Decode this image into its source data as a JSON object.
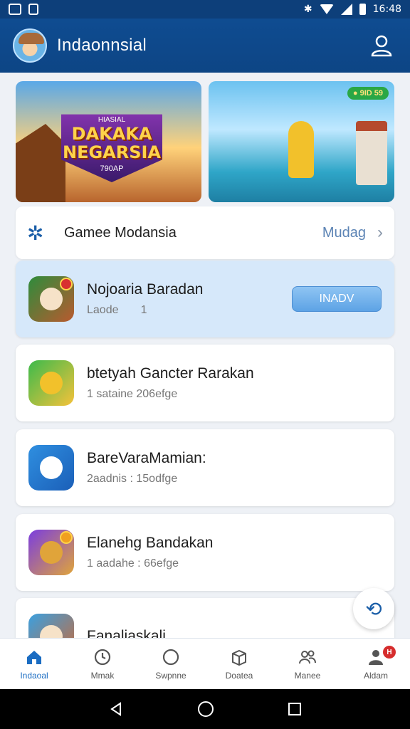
{
  "status": {
    "time": "16:48"
  },
  "appbar": {
    "title": "Indaonnsial",
    "icons": {
      "avatar": "avatar",
      "user": "user-icon"
    }
  },
  "banners": [
    {
      "sup": "HIASIAL",
      "line1": "DAKAKA",
      "line2": "NEGARSIA",
      "line3": "790AP"
    },
    {
      "badge": "● 9ID 59"
    }
  ],
  "section": {
    "label": "Gamee Modansia",
    "more": "Mudag"
  },
  "apps": [
    {
      "name": "Nojoaria Baradan",
      "meta": "Laode       1",
      "action": "INADV",
      "featured": true
    },
    {
      "name": "btetyah Gancter Rarakan",
      "meta": "1 sataine 206efge"
    },
    {
      "name": "BareVaraMamian:",
      "meta": "2aadnis : 15odfge"
    },
    {
      "name": "Elanehg Bandakan",
      "meta": "1 aadahe : 66efge"
    },
    {
      "name": "Fanaliaskali",
      "meta": ""
    }
  ],
  "bottom_nav": [
    {
      "label": "Indaoal",
      "icon": "home-icon",
      "active": true
    },
    {
      "label": "Mmak",
      "icon": "clock-icon"
    },
    {
      "label": "Swpnne",
      "icon": "circle-icon"
    },
    {
      "label": "Doatea",
      "icon": "box-icon"
    },
    {
      "label": "Manee",
      "icon": "people-icon"
    },
    {
      "label": "Aldam",
      "icon": "person-icon",
      "badge": "H"
    }
  ],
  "colors": {
    "primary": "#0f4c91",
    "accent": "#1a6cc2",
    "featured_bg": "#d6e8fa"
  }
}
